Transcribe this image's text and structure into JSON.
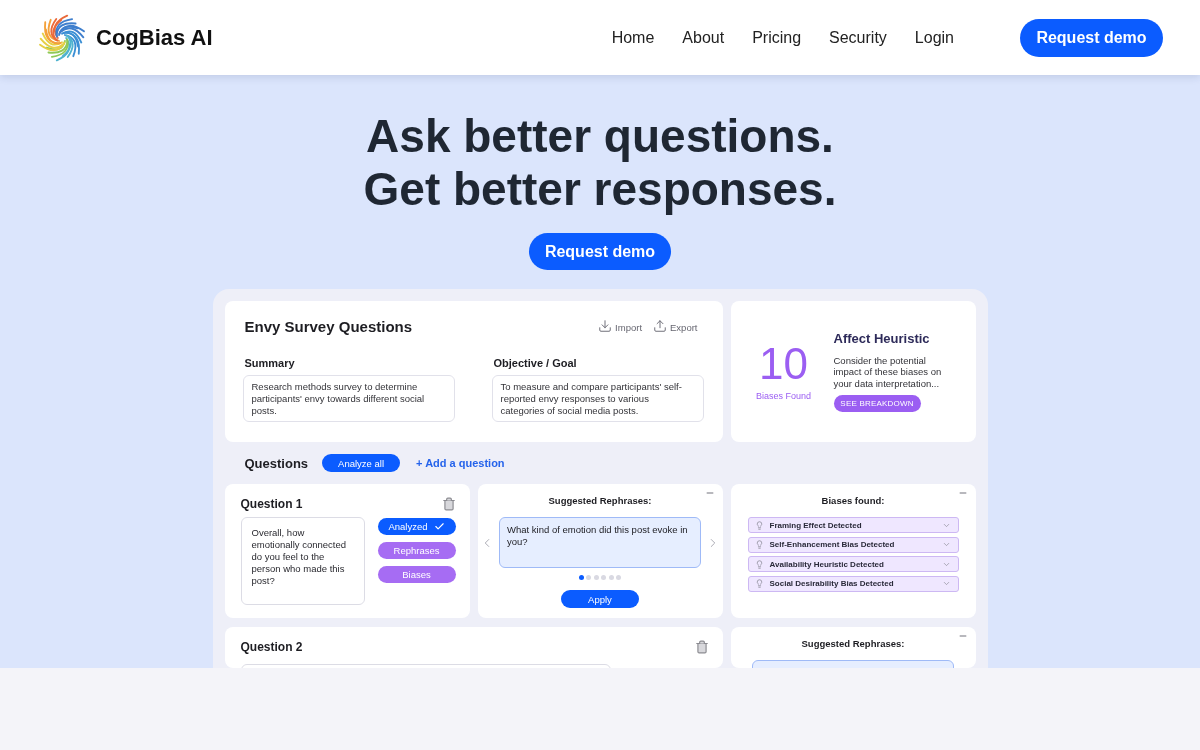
{
  "header": {
    "brand": "CogBias AI",
    "nav": [
      "Home",
      "About",
      "Pricing",
      "Security",
      "Login"
    ],
    "cta": "Request demo"
  },
  "hero": {
    "title_lines": [
      "Ask better questions.",
      "Get better responses."
    ],
    "cta": "Request demo"
  },
  "dashboard": {
    "survey": {
      "title": "Envy Survey Questions",
      "actions": [
        {
          "kind": "import",
          "label": "Import"
        },
        {
          "kind": "export",
          "label": "Export"
        }
      ],
      "fields": [
        {
          "label": "Summary",
          "value": "Research methods survey to determine participants' envy towards different social posts."
        },
        {
          "label": "Objective / Goal",
          "value": "To measure and compare participants' self-reported envy responses to various categories of social media posts."
        }
      ]
    },
    "bias_summary": {
      "count": "10",
      "count_label": "Biases Found",
      "title": "Affect Heuristic",
      "description": "Consider the potential impact of these biases on your data interpretation...",
      "button": "SEE BREAKDOWN"
    },
    "questions_bar": {
      "title": "Questions",
      "analyze_button": "Analyze all",
      "add_link": "+ Add a question"
    },
    "rows": [
      {
        "panels": [
          {
            "kind": "question",
            "title": "Question 1",
            "text": "Overall, how emotionally connected do you feel to the person who made this post?",
            "buttons": [
              {
                "kind": "analyzed",
                "label": "Analyzed"
              },
              {
                "kind": "panel",
                "label": "Rephrases"
              },
              {
                "kind": "panel",
                "label": "Biases"
              }
            ]
          },
          {
            "kind": "rephrases",
            "title": "Suggested Rephrases:",
            "suggestion": "What kind of emotion did this post evoke in you?",
            "pages": [
              {
                "selected": true
              },
              {
                "selected": false
              },
              {
                "selected": false
              },
              {
                "selected": false
              },
              {
                "selected": false
              },
              {
                "selected": false
              }
            ],
            "apply": "Apply"
          },
          {
            "kind": "biases",
            "title": "Biases found:",
            "items": [
              {
                "label": "Framing Effect Detected",
                "expanded": false
              },
              {
                "label": "Self-Enhancement Bias Detected",
                "expanded": false
              },
              {
                "label": "Availability Heuristic Detected",
                "expanded": false
              },
              {
                "label": "Social Desirability Bias Detected",
                "expanded": false
              }
            ]
          }
        ]
      },
      {
        "panels": [
          {
            "kind": "question",
            "title": "Question 2"
          },
          {
            "kind": "rephrases",
            "title": "Suggested Rephrases:"
          }
        ]
      }
    ]
  }
}
